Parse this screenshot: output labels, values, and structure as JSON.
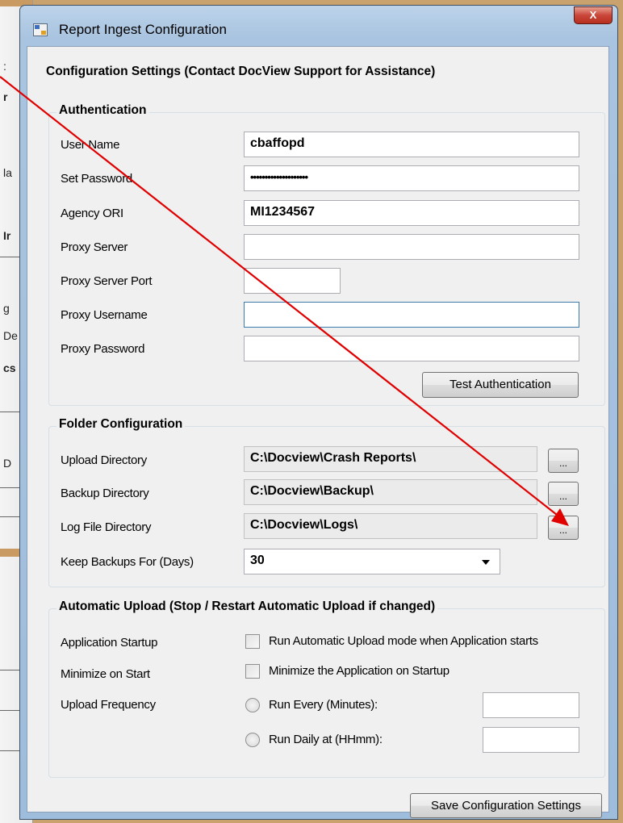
{
  "background_fragments": [
    ":",
    "r",
    "la",
    "Ir",
    "g",
    "De",
    "cs",
    "D"
  ],
  "window": {
    "title": "Report Ingest Configuration",
    "close_glyph": "X"
  },
  "header": "Configuration Settings (Contact DocView Support for Assistance)",
  "authentication": {
    "group_title": "Authentication",
    "user_name_label": "User Name",
    "user_name_value": "cbaffopd",
    "password_label": "Set Password",
    "password_value": "••••••••••••••••••••",
    "agency_ori_label": "Agency ORI",
    "agency_ori_value": "MI1234567",
    "proxy_server_label": "Proxy Server",
    "proxy_server_value": "",
    "proxy_port_label": "Proxy Server Port",
    "proxy_port_value": "",
    "proxy_username_label": "Proxy Username",
    "proxy_username_value": "",
    "proxy_password_label": "Proxy Password",
    "proxy_password_value": "",
    "test_button": "Test Authentication"
  },
  "folders": {
    "group_title": "Folder Configuration",
    "upload_label": "Upload Directory",
    "upload_value": "C:\\Docview\\Crash Reports\\",
    "backup_label": "Backup Directory",
    "backup_value": "C:\\Docview\\Backup\\",
    "log_label": "Log File Directory",
    "log_value": "C:\\Docview\\Logs\\",
    "browse_button": "...",
    "keep_label": "Keep Backups For (Days)",
    "keep_value": "30"
  },
  "auto_upload": {
    "group_title": "Automatic Upload (Stop / Restart Automatic Upload if changed)",
    "startup_label": "Application Startup",
    "startup_checkbox": "Run Automatic Upload mode when Application starts",
    "startup_checked": false,
    "minimize_label": "Minimize on Start",
    "minimize_checkbox": "Minimize the Application on Startup",
    "minimize_checked": false,
    "frequency_label": "Upload Frequency",
    "run_every_radio": "Run Every (Minutes):",
    "run_every_value": "",
    "run_daily_radio": "Run Daily at (HHmm):",
    "run_daily_value": ""
  },
  "save_button": "Save Configuration Settings",
  "annotation": {
    "color": "#e00000"
  }
}
